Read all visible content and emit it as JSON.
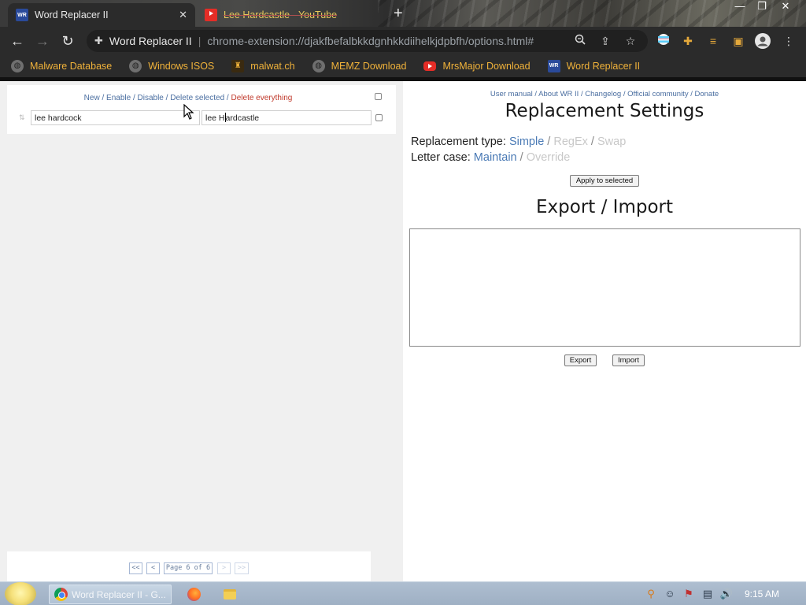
{
  "browser": {
    "tabs": [
      {
        "title": "Word Replacer II",
        "favicon": "word-replacer-icon",
        "active": true
      },
      {
        "title": "Lee Hardcastle - YouTube",
        "favicon": "youtube-icon",
        "active": false
      }
    ],
    "omnibox": {
      "site_name": "Word Replacer II",
      "url": "chrome-extension://djakfbefalbkkdgnhkkdiihelkjdpbfh/options.html#"
    },
    "bookmarks": [
      {
        "label": "Malware Database",
        "icon": "globe-icon"
      },
      {
        "label": "Windows ISOS",
        "icon": "globe-icon"
      },
      {
        "label": "malwat.ch",
        "icon": "malwatch-icon"
      },
      {
        "label": "MEMZ Download",
        "icon": "globe-icon"
      },
      {
        "label": "MrsMajor Download",
        "icon": "youtube-icon"
      },
      {
        "label": "Word Replacer II",
        "icon": "word-replacer-icon"
      }
    ],
    "favicon_text": "WR"
  },
  "left": {
    "actions": [
      {
        "label": "New",
        "danger": false
      },
      {
        "label": "Enable",
        "danger": false
      },
      {
        "label": "Disable",
        "danger": false
      },
      {
        "label": "Delete selected",
        "danger": false
      },
      {
        "label": "Delete everything",
        "danger": true
      }
    ],
    "replacement_row": {
      "find_value": "lee hardcock",
      "replace_before_caret": "lee H",
      "replace_after_caret": "ardcastle"
    },
    "pager": {
      "first": "<<",
      "prev": "<",
      "status": "Page 6 of 6",
      "next": ">",
      "last": ">>"
    }
  },
  "right": {
    "links": [
      "User manual",
      "About WR II",
      "Changelog",
      "Official community",
      "Donate"
    ],
    "settings_title": "Replacement Settings",
    "replacement_type_label": "Replacement type:",
    "replacement_types": [
      {
        "label": "Simple",
        "selected": true
      },
      {
        "label": "RegEx",
        "selected": false
      },
      {
        "label": "Swap",
        "selected": false
      }
    ],
    "letter_case_label": "Letter case:",
    "letter_cases": [
      {
        "label": "Maintain",
        "selected": true
      },
      {
        "label": "Override",
        "selected": false
      }
    ],
    "apply_button": "Apply to selected",
    "export_title": "Export / Import",
    "export_text": "",
    "export_button": "Export",
    "import_button": "Import"
  },
  "taskbar": {
    "active_window": "Word Replacer II - G...",
    "clock": "9:15 AM"
  },
  "colors": {
    "link": "#4a6ea0",
    "danger_link": "#c0392b",
    "option_selected": "#4a7ab5",
    "option_unselected": "#c8c8c8",
    "bookmark_text": "#f0b23a"
  }
}
